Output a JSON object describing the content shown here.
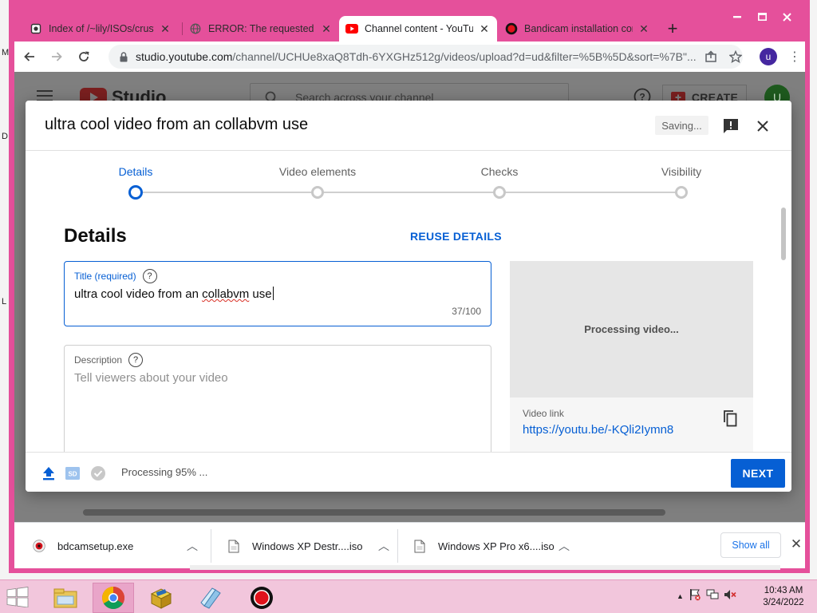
{
  "browser": {
    "tabs": [
      {
        "label": "Index of /~lily/ISOs/crust",
        "active": false
      },
      {
        "label": "ERROR: The requested UR",
        "active": false
      },
      {
        "label": "Channel content - YouTub",
        "active": true
      },
      {
        "label": "Bandicam installation com",
        "active": false
      }
    ],
    "url_domain": "studio.youtube.com",
    "url_path": "/channel/UCHUe8xaQ8Tdh-6YXGHz512g/videos/upload?d=ud&filter=%5B%5D&sort=%7B\"...",
    "profile_letter": "u"
  },
  "studio": {
    "logo_text": "Studio",
    "search_placeholder": "Search across your channel",
    "create_label": "CREATE",
    "avatar_letter": "U"
  },
  "dialog": {
    "title": "ultra cool video from an collabvm use",
    "saving_label": "Saving...",
    "steps": [
      {
        "label": "Details",
        "active": true
      },
      {
        "label": "Video elements",
        "active": false
      },
      {
        "label": "Checks",
        "active": false
      },
      {
        "label": "Visibility",
        "active": false
      }
    ],
    "section_heading": "Details",
    "reuse_label": "REUSE DETAILS",
    "title_field": {
      "label": "Title (required)",
      "value_before": "ultra cool video from an ",
      "value_misspelled": "collabvm",
      "value_after": " use",
      "count": "37/100"
    },
    "description_field": {
      "label": "Description",
      "placeholder": "Tell viewers about your video"
    },
    "preview": {
      "status": "Processing video...",
      "link_label": "Video link",
      "link_url": "https://youtu.be/-KQli2Iymn8"
    },
    "footer": {
      "processing_text": "Processing 95% ...",
      "processing_progress": 0.95,
      "next_label": "NEXT"
    }
  },
  "downloads": {
    "items": [
      {
        "name": "bdcamsetup.exe"
      },
      {
        "name": "Windows XP Destr....iso"
      },
      {
        "name": "Windows XP Pro x6....iso"
      }
    ],
    "show_all_label": "Show all"
  },
  "taskbar": {
    "time": "10:43 AM",
    "date": "3/24/2022"
  },
  "colors": {
    "accent": "#065fd4",
    "window_frame": "#e5509b",
    "taskbar": "#f2c6dc"
  }
}
